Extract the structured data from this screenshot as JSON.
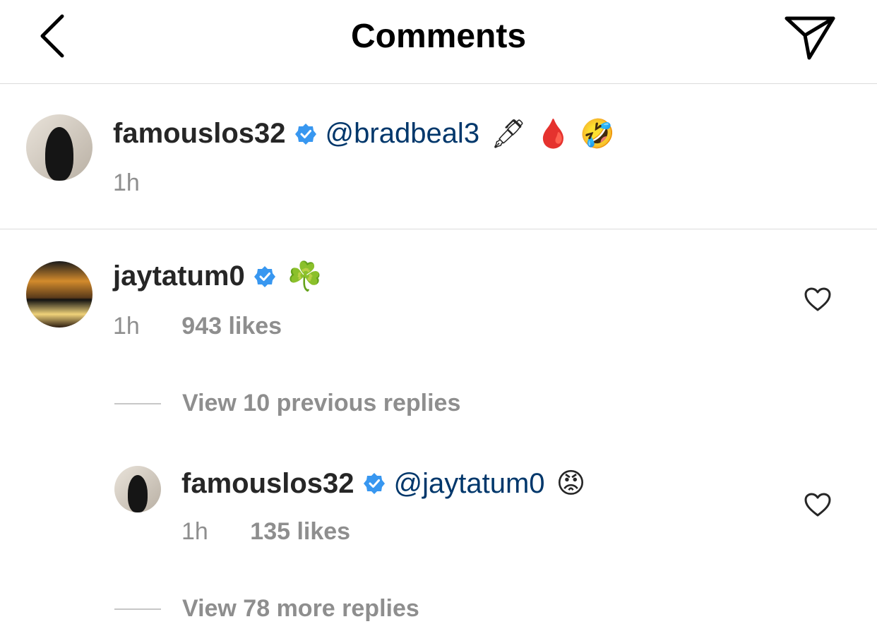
{
  "header": {
    "title": "Comments",
    "back_icon": "chevron-left-icon",
    "send_icon": "paper-plane-icon"
  },
  "caption": {
    "username": "famouslos32",
    "mention": "@bradbeal3",
    "emojis": "🖋 🩸 🤣",
    "time": "1h"
  },
  "comments": [
    {
      "username": "jaytatum0",
      "emoji": "☘️",
      "time": "1h",
      "likes": "943 likes",
      "view_previous": "View 10 previous replies",
      "replies": [
        {
          "username": "famouslos32",
          "mention": "@jaytatum0",
          "emoji": "😡",
          "time": "1h",
          "likes": "135 likes"
        }
      ],
      "view_more": "View 78 more replies"
    }
  ],
  "colors": {
    "mention": "#00376b",
    "verified": "#3897f0",
    "meta": "#8e8e8e"
  }
}
